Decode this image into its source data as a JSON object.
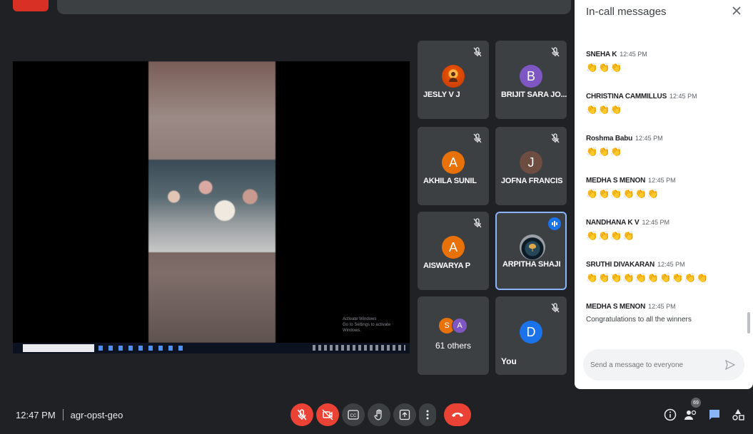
{
  "meeting": {
    "time": "12:47 PM",
    "code": "agr-opst-geo"
  },
  "presentation": {
    "watermark_title": "Activate Windows",
    "watermark_sub": "Go to Settings to activate Windows."
  },
  "participants": [
    {
      "name": "JESLY V J",
      "initial": "",
      "color": "#e8710a",
      "muted": true
    },
    {
      "name": "BRIJIT SARA JO...",
      "initial": "B",
      "color": "#7e57c2",
      "muted": true
    },
    {
      "name": "AKHILA SUNIL",
      "initial": "A",
      "color": "#e8710a",
      "muted": true
    },
    {
      "name": "JOFNA FRANCIS",
      "initial": "J",
      "color": "#6d4c41",
      "muted": true
    },
    {
      "name": "AISWARYA P",
      "initial": "A",
      "color": "#e8710a",
      "muted": true
    },
    {
      "name": "ARPITHA SHAJI",
      "initial": "",
      "color": "#1b2a36",
      "muted": false,
      "speaking": true
    }
  ],
  "others": {
    "label": "61 others",
    "initials": [
      "S",
      "A"
    ]
  },
  "self": {
    "label": "You",
    "initial": "D",
    "color": "#1a73e8"
  },
  "chat": {
    "title": "In-call messages",
    "messages": [
      {
        "sender": "SNEHA K",
        "time": "12:45 PM",
        "body": "👏👏👏"
      },
      {
        "sender": "CHRISTINA CAMMILLUS",
        "time": "12:45 PM",
        "body": "👏👏👏"
      },
      {
        "sender": "Roshma Babu",
        "time": "12:45 PM",
        "body": "👏👏👏"
      },
      {
        "sender": "MEDHA S MENON",
        "time": "12:45 PM",
        "body": "👏👏👏👏👏👏"
      },
      {
        "sender": "NANDHANA K V",
        "time": "12:45 PM",
        "body": "👏👏👏👏"
      },
      {
        "sender": "SRUTHI DIVAKARAN",
        "time": "12:45 PM",
        "body": "👏👏👏👏👏👏👏👏👏👏"
      },
      {
        "sender": "MEDHA S MENON",
        "time": "12:45 PM",
        "body": "Congratulations to all the winners",
        "text": true
      }
    ],
    "input_placeholder": "Send a message to everyone"
  },
  "people_count": "69",
  "colors": {
    "bg": "#202124",
    "tile": "#3c4043",
    "danger": "#ea4335",
    "accent": "#8ab4f8",
    "primary": "#1a73e8"
  }
}
